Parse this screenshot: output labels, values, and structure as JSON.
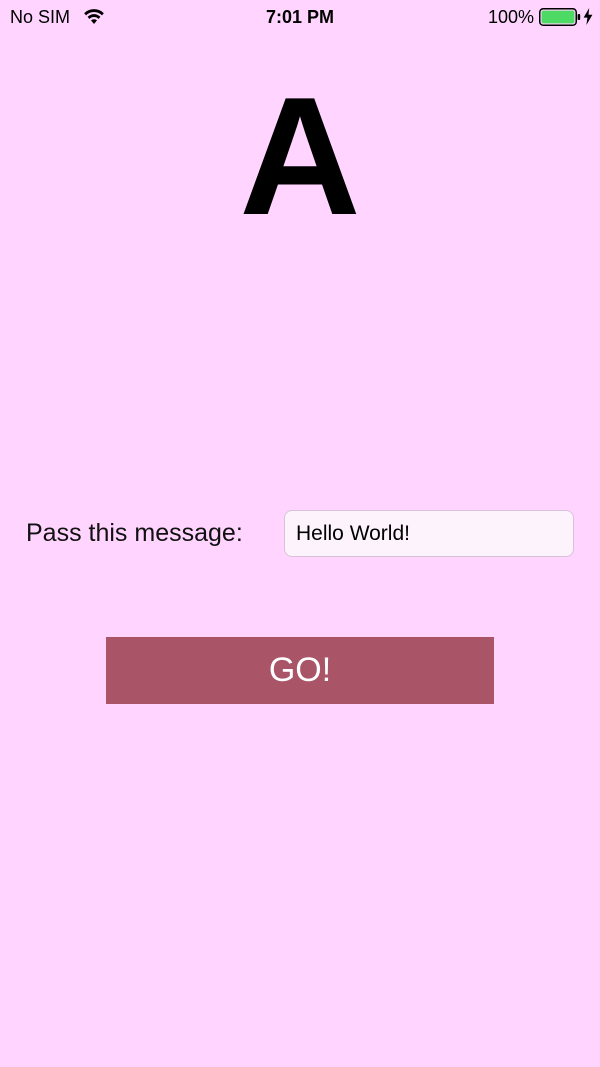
{
  "status_bar": {
    "carrier": "No SIM",
    "time": "7:01 PM",
    "battery_percent": "100%",
    "wifi_icon": "wifi-icon",
    "battery_icon": "battery-full-icon",
    "charging_icon": "charging-bolt-icon",
    "battery_level": 1.0
  },
  "screen": {
    "title_letter": "A",
    "message_label": "Pass this message:",
    "message_value": "Hello World!",
    "go_button_label": "GO!"
  },
  "colors": {
    "background": "#FFD5FF",
    "button": "#A95467",
    "battery_fill": "#4CD964"
  }
}
